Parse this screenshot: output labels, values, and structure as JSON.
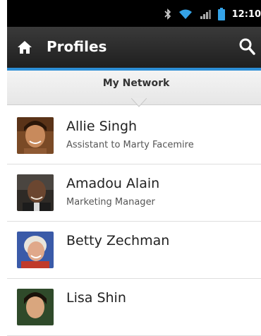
{
  "status_bar": {
    "time": "12:10",
    "icons": [
      "bluetooth-icon",
      "wifi-icon",
      "signal-icon",
      "battery-icon"
    ]
  },
  "app_bar": {
    "title": "Profiles",
    "home_icon": "home-icon",
    "search_icon": "search-icon"
  },
  "tab": {
    "label": "My Network"
  },
  "profiles": [
    {
      "name": "Allie Singh",
      "subtitle": "Assistant to Marty Facemire"
    },
    {
      "name": "Amadou Alain",
      "subtitle": "Marketing Manager"
    },
    {
      "name": "Betty Zechman",
      "subtitle": ""
    },
    {
      "name": "Lisa Shin",
      "subtitle": ""
    }
  ],
  "colors": {
    "accent": "#2d8fd6",
    "app_bar": "#2a2a2a",
    "status_bar": "#000000"
  }
}
